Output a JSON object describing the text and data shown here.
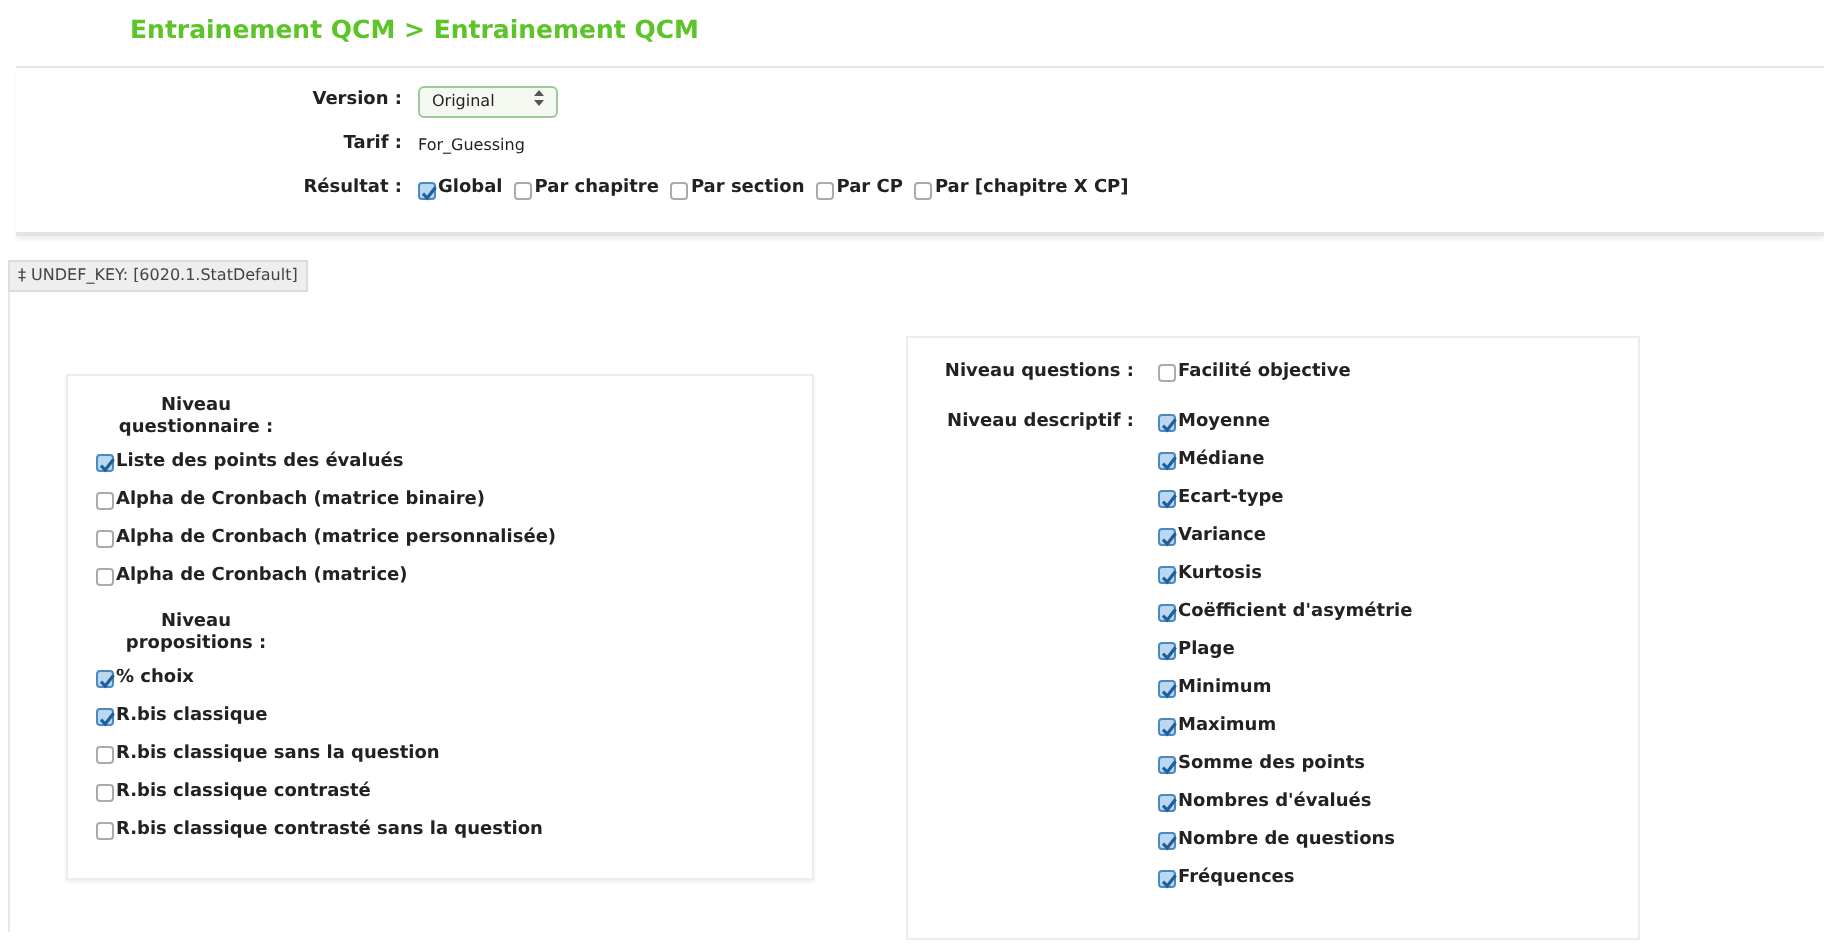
{
  "title": "Entrainement QCM > Entrainement QCM",
  "form": {
    "version": {
      "label": "Version :",
      "value": "Original"
    },
    "tarif": {
      "label": "Tarif :",
      "value": "For_Guessing"
    },
    "resultat": {
      "label": "Résultat :",
      "options": [
        {
          "label": "Global",
          "checked": true
        },
        {
          "label": "Par chapitre",
          "checked": false
        },
        {
          "label": "Par section",
          "checked": false
        },
        {
          "label": "Par CP",
          "checked": false
        },
        {
          "label": "Par [chapitre X CP]",
          "checked": false
        }
      ]
    }
  },
  "section_tab": {
    "icon": "‡",
    "label": "UNDEF_KEY: [6020.1.StatDefault]"
  },
  "left_panel": [
    {
      "heading": "Niveau questionnaire :",
      "items": [
        {
          "label": "Liste des points des évalués",
          "checked": true
        },
        {
          "label": "Alpha de Cronbach (matrice binaire)",
          "checked": false
        },
        {
          "label": "Alpha de Cronbach (matrice personnalisée)",
          "checked": false
        },
        {
          "label": "Alpha de Cronbach (matrice)",
          "checked": false
        }
      ]
    },
    {
      "heading": "Niveau propositions :",
      "items": [
        {
          "label": "% choix",
          "checked": true
        },
        {
          "label": "R.bis classique",
          "checked": true
        },
        {
          "label": "R.bis classique sans la question",
          "checked": false
        },
        {
          "label": "R.bis classique contrasté",
          "checked": false
        },
        {
          "label": "R.bis classique contrasté sans la question",
          "checked": false
        }
      ]
    }
  ],
  "right_panel": [
    {
      "label": "Niveau questions :",
      "items": [
        {
          "label": "Facilité objective",
          "checked": false
        }
      ]
    },
    {
      "label": "Niveau descriptif :",
      "items": [
        {
          "label": "Moyenne",
          "checked": true
        },
        {
          "label": "Médiane",
          "checked": true
        },
        {
          "label": "Ecart-type",
          "checked": true
        },
        {
          "label": "Variance",
          "checked": true
        },
        {
          "label": "Kurtosis",
          "checked": true
        },
        {
          "label": "Coëfficient d'asymétrie",
          "checked": true
        },
        {
          "label": "Plage",
          "checked": true
        },
        {
          "label": "Minimum",
          "checked": true
        },
        {
          "label": "Maximum",
          "checked": true
        },
        {
          "label": "Somme des points",
          "checked": true
        },
        {
          "label": "Nombres d'évalués",
          "checked": true
        },
        {
          "label": "Nombre de questions",
          "checked": true
        },
        {
          "label": "Fréquences",
          "checked": true
        }
      ]
    }
  ]
}
